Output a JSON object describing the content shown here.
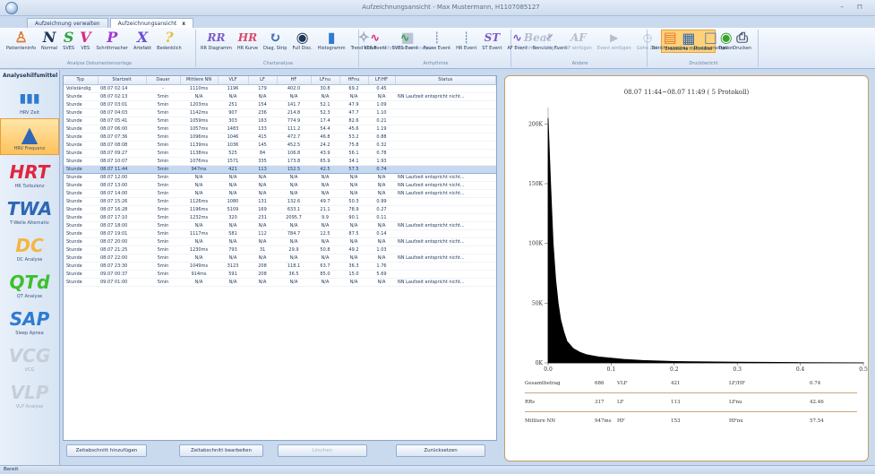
{
  "window": {
    "title": "Aufzeichnungsansicht - Max Mustermann, H1107085127"
  },
  "tabs": [
    {
      "label": "Aufzeichnung verwalten"
    },
    {
      "label": "Aufzeichnungsansicht",
      "close": "x"
    }
  ],
  "ribbon": {
    "groups": [
      {
        "label": "Analyse Dokumentenvorlage"
      },
      {
        "label": "Chartanalyse"
      },
      {
        "label": "Arrhythmie"
      },
      {
        "label": "Andere"
      },
      {
        "label": "Druckbericht"
      }
    ],
    "buttons": {
      "patienteninfo": "Patienteninfo",
      "normal": "Normal",
      "sves": "SVES",
      "ves": "VES",
      "schrittmacher": "Schrittmacher",
      "artefakt": "Artefakt",
      "bedenklich": "Bedenklich",
      "rr_diagramm": "RR Diagramm",
      "hr_kurve": "HR Kurve",
      "diag_strip": "Diag. Strip",
      "full_disc": "Full Disc.",
      "histogramm": "Histogramm",
      "trend_kurve": "Trend kurve",
      "schrittmacher_analyse": "Schrittmacher Analyse",
      "ves_event": "VES Event",
      "sves_event": "SVES Event",
      "pause_event": "Pause Event",
      "hr_event": "HR Event",
      "st_event": "ST Event",
      "af_event": "AF Event",
      "benutzer_event": "Benutzer Event",
      "rhythmus_einfuegen": "Rhythmus einfügen",
      "af_einfuegen": "AF einfügen",
      "event_einfuegen": "Event einfügen",
      "gehe_zeit": "Gehe Zeit",
      "erweiterte_hilfsmittel": "Erweiterte Hilfsmittel",
      "option": "Option",
      "berichtvorschau": "Berichtvorschau",
      "druckvorschau": "Druckvorschau",
      "drucken": "Drucken"
    }
  },
  "leftnav": {
    "title": "Analysehilfsmittel",
    "items": [
      {
        "logo": "▮▮▮",
        "label": "HRV Zeit"
      },
      {
        "logo": "▲",
        "label": "HRV Frequenz"
      },
      {
        "logo": "HRT",
        "label": "HR Turbulenz"
      },
      {
        "logo": "TWA",
        "label": "T-Welle Alternativ"
      },
      {
        "logo": "DC",
        "label": "DC Analyse"
      },
      {
        "logo": "QTd",
        "label": "QT Analyse"
      },
      {
        "logo": "SAP",
        "label": "Sleep Apnea"
      },
      {
        "logo": "VCG",
        "label": "VCG"
      },
      {
        "logo": "VLP",
        "label": "VLP Analyse"
      }
    ]
  },
  "table": {
    "columns": [
      "Typ",
      "Startzeit",
      "Dauer",
      "Mittlere NN",
      "VLF",
      "LF",
      "HF",
      "LFnu",
      "HFnu",
      "LF/HF",
      "Status"
    ],
    "rows": [
      [
        "Vollständig",
        "08.07 02:14",
        "-",
        "1110ms",
        "1196",
        "179",
        "402.0",
        "30.8",
        "69.2",
        "0.45",
        ""
      ],
      [
        "Stunde",
        "08.07 02:13",
        "5min",
        "N/A",
        "N/A",
        "N/A",
        "N/A",
        "N/A",
        "N/A",
        "N/A",
        "NN Laufzeit entspricht nicht..."
      ],
      [
        "Stunde",
        "08.07 03:01",
        "5min",
        "1203ms",
        "251",
        "154",
        "141.7",
        "52.1",
        "47.9",
        "1.09",
        ""
      ],
      [
        "Stunde",
        "08.07 04:03",
        "5min",
        "1142ms",
        "907",
        "236",
        "214.8",
        "52.3",
        "47.7",
        "1.10",
        ""
      ],
      [
        "Stunde",
        "08.07 05:41",
        "5min",
        "1059ms",
        "303",
        "163",
        "774.9",
        "17.4",
        "82.6",
        "0.21",
        ""
      ],
      [
        "Stunde",
        "08.07 06:00",
        "5min",
        "1057ms",
        "1483",
        "133",
        "111.2",
        "54.4",
        "45.6",
        "1.19",
        ""
      ],
      [
        "Stunde",
        "08.07 07:36",
        "5min",
        "1096ms",
        "1046",
        "415",
        "472.7",
        "46.8",
        "53.2",
        "0.88",
        ""
      ],
      [
        "Stunde",
        "08.07 08:08",
        "5min",
        "1139ms",
        "1036",
        "145",
        "452.5",
        "24.2",
        "75.8",
        "0.32",
        ""
      ],
      [
        "Stunde",
        "08.07 09:27",
        "5min",
        "1138ms",
        "525",
        "84",
        "106.8",
        "43.9",
        "56.1",
        "0.78",
        ""
      ],
      [
        "Stunde",
        "08.07 10:07",
        "5min",
        "1076ms",
        "1571",
        "335",
        "173.8",
        "65.9",
        "34.1",
        "1.93",
        ""
      ],
      [
        "Stunde",
        "08.07 11:44",
        "5min",
        "947ms",
        "421",
        "113",
        "152.5",
        "42.5",
        "57.5",
        "0.74",
        ""
      ],
      [
        "Stunde",
        "08.07 12:00",
        "5min",
        "N/A",
        "N/A",
        "N/A",
        "N/A",
        "N/A",
        "N/A",
        "N/A",
        "NN Laufzeit entspricht nicht..."
      ],
      [
        "Stunde",
        "08.07 13:00",
        "5min",
        "N/A",
        "N/A",
        "N/A",
        "N/A",
        "N/A",
        "N/A",
        "N/A",
        "NN Laufzeit entspricht nicht..."
      ],
      [
        "Stunde",
        "08.07 14:00",
        "5min",
        "N/A",
        "N/A",
        "N/A",
        "N/A",
        "N/A",
        "N/A",
        "N/A",
        "NN Laufzeit entspricht nicht..."
      ],
      [
        "Stunde",
        "08.07 15:26",
        "5min",
        "1126ms",
        "1080",
        "131",
        "132.6",
        "49.7",
        "50.3",
        "0.99",
        ""
      ],
      [
        "Stunde",
        "08.07 16:28",
        "5min",
        "1196ms",
        "5109",
        "169",
        "633.1",
        "21.1",
        "78.9",
        "0.27",
        ""
      ],
      [
        "Stunde",
        "08.07 17:10",
        "5min",
        "1232ms",
        "320",
        "231",
        "2095.7",
        "9.9",
        "90.1",
        "0.11",
        ""
      ],
      [
        "Stunde",
        "08.07 18:00",
        "5min",
        "N/A",
        "N/A",
        "N/A",
        "N/A",
        "N/A",
        "N/A",
        "N/A",
        "NN Laufzeit entspricht nicht..."
      ],
      [
        "Stunde",
        "08.07 19:01",
        "5min",
        "1117ms",
        "581",
        "112",
        "784.7",
        "12.5",
        "87.5",
        "0.14",
        ""
      ],
      [
        "Stunde",
        "08.07 20:00",
        "5min",
        "N/A",
        "N/A",
        "N/A",
        "N/A",
        "N/A",
        "N/A",
        "N/A",
        "NN Laufzeit entspricht nicht..."
      ],
      [
        "Stunde",
        "08.07 21:25",
        "5min",
        "1230ms",
        "793",
        "31",
        "29.9",
        "50.8",
        "49.2",
        "1.03",
        ""
      ],
      [
        "Stunde",
        "08.07 22:00",
        "5min",
        "N/A",
        "N/A",
        "N/A",
        "N/A",
        "N/A",
        "N/A",
        "N/A",
        "NN Laufzeit entspricht nicht..."
      ],
      [
        "Stunde",
        "08.07 23:30",
        "5min",
        "1049ms",
        "3123",
        "208",
        "118.1",
        "63.7",
        "36.3",
        "1.76",
        ""
      ],
      [
        "Stunde",
        "09.07 00:37",
        "5min",
        "914ms",
        "591",
        "208",
        "36.5",
        "85.0",
        "15.0",
        "5.69",
        ""
      ],
      [
        "Stunde",
        "09.07 01:00",
        "5min",
        "N/A",
        "N/A",
        "N/A",
        "N/A",
        "N/A",
        "N/A",
        "N/A",
        "NN Laufzeit entspricht nicht..."
      ]
    ],
    "selected_row": 10
  },
  "buttons": {
    "add": "Zeitabschnitt hinzufügen",
    "edit": "Zeitabschnitt bearbeiten",
    "delete": "Löschen",
    "reset": "Zurücksetzen"
  },
  "chart_data": {
    "type": "area",
    "title": "08.07 11:44~08.07 11:49 ( 5 Protokoll)",
    "x": [
      0.0,
      0.004,
      0.008,
      0.012,
      0.016,
      0.02,
      0.025,
      0.03,
      0.04,
      0.05,
      0.06,
      0.07,
      0.08,
      0.1,
      0.12,
      0.15,
      0.2,
      0.3,
      0.4,
      0.5
    ],
    "values": [
      205000,
      150000,
      100000,
      70000,
      50000,
      36000,
      26000,
      18000,
      12000,
      9000,
      7000,
      6000,
      5000,
      4000,
      3000,
      2000,
      1200,
      600,
      300,
      100
    ],
    "xlim": [
      0,
      0.5
    ],
    "ylim": [
      0,
      210000
    ],
    "xticks": [
      "0.0",
      "0.1",
      "0.2",
      "0.3",
      "0.4",
      "0.5"
    ],
    "yticks": [
      "0K",
      "50K",
      "100K",
      "150K",
      "200K"
    ],
    "color": "#000000"
  },
  "stats": {
    "rows": [
      [
        {
          "k": "Gesamtbetrag",
          "v": "686"
        },
        {
          "k": "VLF",
          "v": "421"
        },
        {
          "k": "LF/HF",
          "v": "0.74"
        }
      ],
      [
        {
          "k": "RRs",
          "v": "317"
        },
        {
          "k": "LF",
          "v": "113"
        },
        {
          "k": "LFnu",
          "v": "42.46"
        }
      ],
      [
        {
          "k": "Mittlere NN",
          "v": "947ms"
        },
        {
          "k": "HF",
          "v": "153"
        },
        {
          "k": "HFnu",
          "v": "57.54"
        }
      ]
    ]
  },
  "status": {
    "text": "Bereit"
  }
}
